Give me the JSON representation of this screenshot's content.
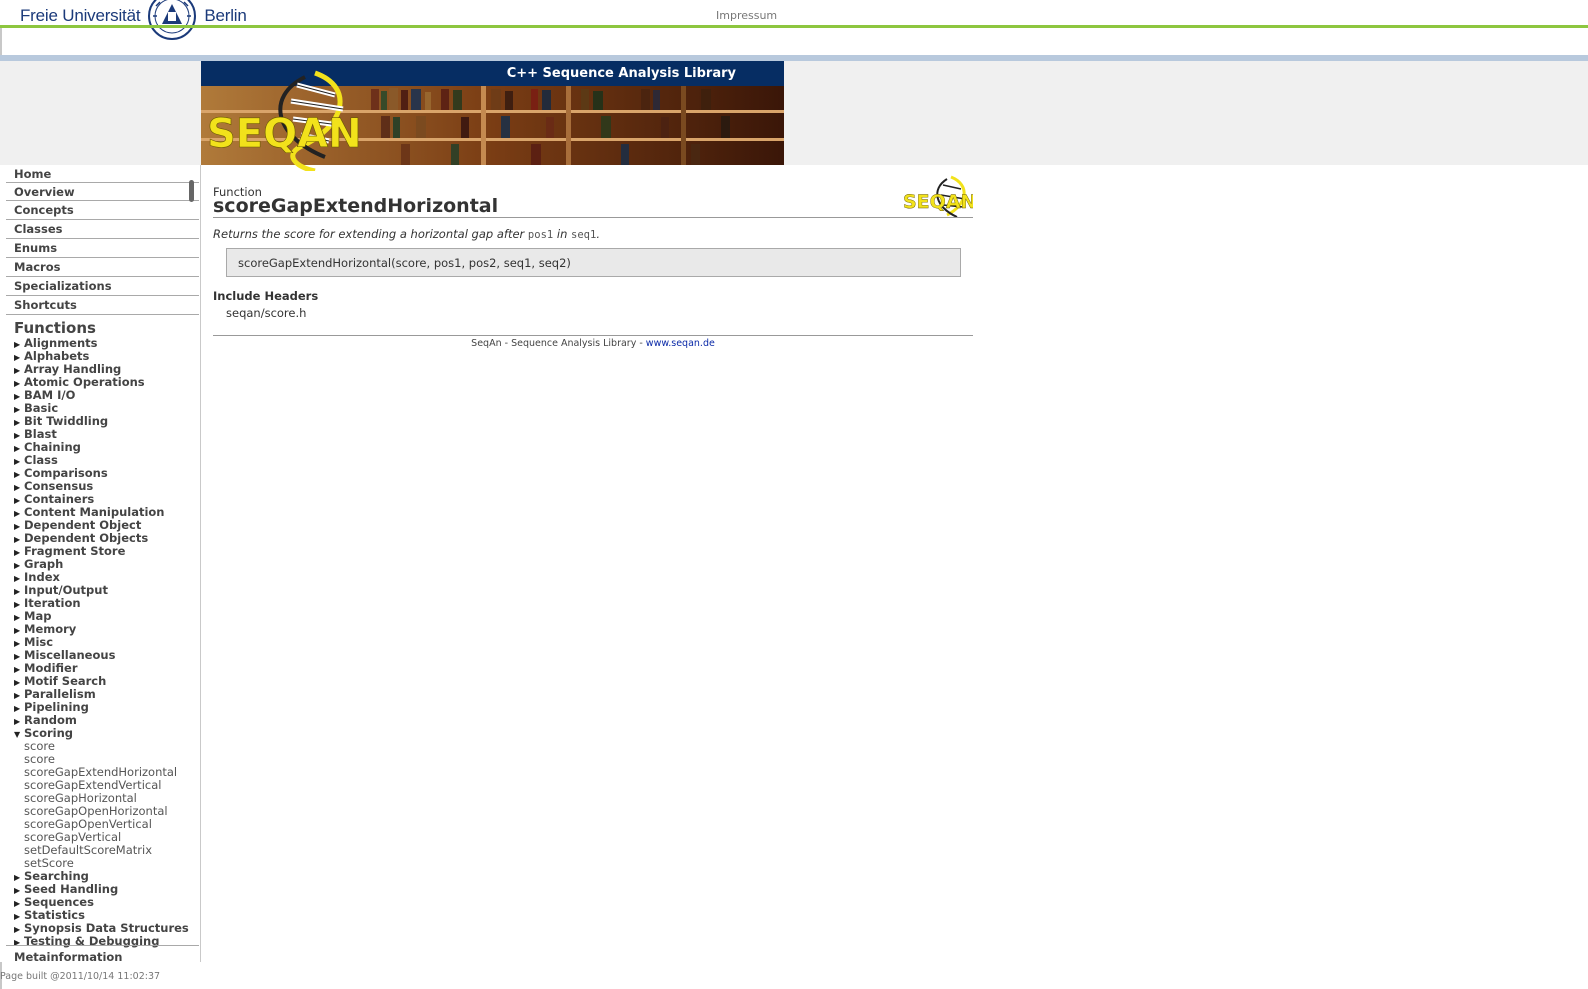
{
  "header": {
    "university_left": "Freie Universität",
    "university_right": "Berlin",
    "impressum": "Impressum"
  },
  "banner": {
    "title": "C++ Sequence Analysis Library",
    "logo_text": "SEQAN"
  },
  "sidebar": {
    "top_links": [
      "Home",
      "Overview",
      "Concepts",
      "Classes",
      "Enums",
      "Macros",
      "Specializations",
      "Shortcuts"
    ],
    "functions_heading": "Functions",
    "categories_before": [
      "Alignments",
      "Alphabets",
      "Array Handling",
      "Atomic Operations",
      "BAM I/O",
      "Basic",
      "Bit Twiddling",
      "Blast",
      "Chaining",
      "Class",
      "Comparisons",
      "Consensus",
      "Containers",
      "Content Manipulation",
      "Dependent Object",
      "Dependent Objects",
      "Fragment Store",
      "Graph",
      "Index",
      "Input/Output",
      "Iteration",
      "Map",
      "Memory",
      "Misc",
      "Miscellaneous",
      "Modifier",
      "Motif Search",
      "Parallelism",
      "Pipelining",
      "Random"
    ],
    "expanded_category": "Scoring",
    "expanded_items": [
      "score",
      "score",
      "scoreGapExtendHorizontal",
      "scoreGapExtendVertical",
      "scoreGapHorizontal",
      "scoreGapOpenHorizontal",
      "scoreGapOpenVertical",
      "scoreGapVertical",
      "setDefaultScoreMatrix",
      "setScore"
    ],
    "categories_after": [
      "Searching",
      "Seed Handling",
      "Sequences",
      "Statistics",
      "Synopsis Data Structures",
      "Testing & Debugging"
    ],
    "cut_off_item": "Metainformation"
  },
  "content": {
    "kind": "Function",
    "title": "scoreGapExtendHorizontal",
    "summary_prefix": "Returns the score for extending a horizontal gap after ",
    "summary_code1": "pos1",
    "summary_mid": " in ",
    "summary_code2": "seq1",
    "summary_suffix": ".",
    "signature": "scoreGapExtendHorizontal(score, pos1, pos2, seq1, seq2)",
    "include_heading": "Include Headers",
    "include_file": "seqan/score.h",
    "footer_prefix": "SeqAn - Sequence Analysis Library - ",
    "footer_link": "www.seqan.de"
  },
  "status": {
    "page_built": "Page built @2011/10/14 11:02:37"
  },
  "colors": {
    "green_line": "#8dc63f",
    "banner_titlebar": "#062d63",
    "link": "#0b2aa8",
    "seqan_yellow": "#f2e21b"
  }
}
